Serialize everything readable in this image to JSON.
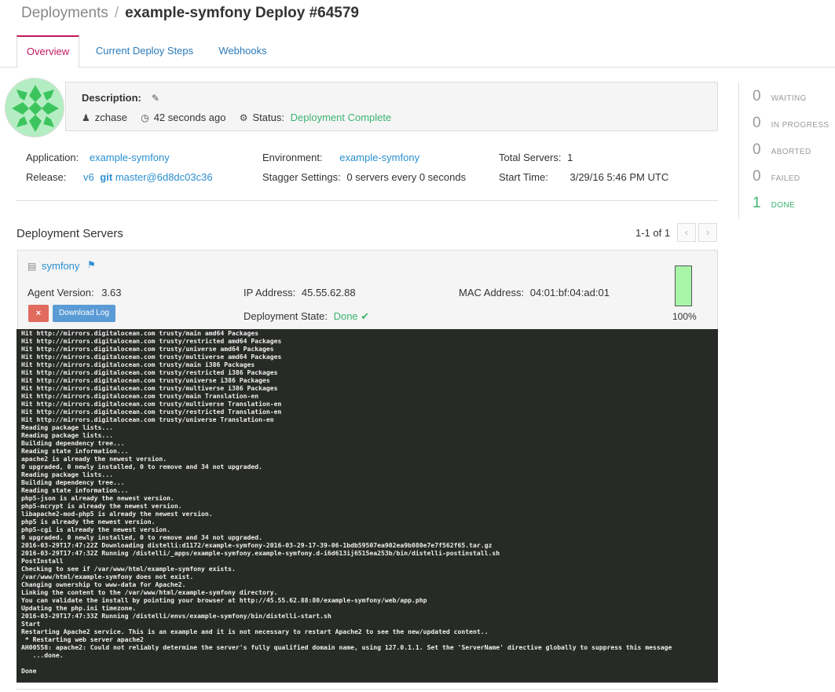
{
  "breadcrumb": {
    "parent": "Deployments",
    "separator": "/",
    "current": "example-symfony Deploy #64579"
  },
  "tabs": [
    {
      "label": "Overview",
      "active": true
    },
    {
      "label": "Current Deploy Steps",
      "active": false
    },
    {
      "label": "Webhooks",
      "active": false
    }
  ],
  "description": {
    "label": "Description:",
    "user": "zchase",
    "time": "42 seconds ago",
    "status_label": "Status:",
    "status_value": "Deployment Complete"
  },
  "info": {
    "application_label": "Application:",
    "application_value": "example-symfony",
    "environment_label": "Environment:",
    "environment_value": "example-symfony",
    "total_servers_label": "Total Servers:",
    "total_servers_value": "1",
    "release_label": "Release:",
    "release_value": "v6",
    "git_label": "git",
    "git_value": "master@6d8dc03c36",
    "stagger_label": "Stagger Settings:",
    "stagger_value": "0 servers every 0 seconds",
    "start_label": "Start Time:",
    "start_value": "3/29/16 5:46 PM UTC"
  },
  "servers": {
    "title": "Deployment Servers",
    "pagination": "1-1 of 1",
    "prev": "‹",
    "next": "›",
    "server": {
      "name": "symfony",
      "agent_label": "Agent Version:",
      "agent_value": "3.63",
      "ip_label": "IP Address:",
      "ip_value": "45.55.62.88",
      "mac_label": "MAC Address:",
      "mac_value": "04:01:bf:04:ad:01",
      "state_label": "Deployment State:",
      "state_value": "Done",
      "abort_label": "×",
      "download_label": "Download Log",
      "progress_text": "100%",
      "progress_fraction": 1.0
    }
  },
  "stats": [
    {
      "value": "0",
      "label": "WAITING"
    },
    {
      "value": "0",
      "label": "IN PROGRESS"
    },
    {
      "value": "0",
      "label": "ABORTED"
    },
    {
      "value": "0",
      "label": "FAILED"
    },
    {
      "value": "1",
      "label": "DONE"
    }
  ],
  "log_lines": [
    "Hit http://mirrors.digitalocean.com trusty/main amd64 Packages",
    "Hit http://mirrors.digitalocean.com trusty/restricted amd64 Packages",
    "Hit http://mirrors.digitalocean.com trusty/universe amd64 Packages",
    "Hit http://mirrors.digitalocean.com trusty/multiverse amd64 Packages",
    "Hit http://mirrors.digitalocean.com trusty/main i386 Packages",
    "Hit http://mirrors.digitalocean.com trusty/restricted i386 Packages",
    "Hit http://mirrors.digitalocean.com trusty/universe i386 Packages",
    "Hit http://mirrors.digitalocean.com trusty/multiverse i386 Packages",
    "Hit http://mirrors.digitalocean.com trusty/main Translation-en",
    "Hit http://mirrors.digitalocean.com trusty/multiverse Translation-en",
    "Hit http://mirrors.digitalocean.com trusty/restricted Translation-en",
    "Hit http://mirrors.digitalocean.com trusty/universe Translation-en",
    "Reading package lists...",
    "Reading package lists...",
    "Building dependency tree...",
    "Reading state information...",
    "apache2 is already the newest version.",
    "0 upgraded, 0 newly installed, 0 to remove and 34 not upgraded.",
    "Reading package lists...",
    "Building dependency tree...",
    "Reading state information...",
    "php5-json is already the newest version.",
    "php5-mcrypt is already the newest version.",
    "libapache2-mod-php5 is already the newest version.",
    "php5 is already the newest version.",
    "php5-cgi is already the newest version.",
    "0 upgraded, 0 newly installed, 0 to remove and 34 not upgraded.",
    "2016-03-29T17:47:22Z Downloading distelli:d1172/example-symfony-2016-03-29-17-39-06-1bdb59507ea902ea9b080e7e7f562f65.tar.gz",
    "2016-03-29T17:47:32Z Running /distelli/_apps/example-symfony.example-symfony.d-i6d613ij6515ea253b/bin/distelli-postinstall.sh",
    "PostInstall",
    "Checking to see if /var/www/html/example-symfony exists.",
    "/var/www/html/example-symfony does not exist.",
    "Changing ownership to www-data for Apache2.",
    "Linking the content to the /var/www/html/example-symfony directory.",
    "You can validate the install by pointing your browser at http://45.55.62.88:80/example-symfony/web/app.php",
    "Updating the php.ini timezone.",
    "2016-03-29T17:47:33Z Running /distelli/envs/example-symfony/bin/distelli-start.sh",
    "Start",
    "Restarting Apache2 service. This is an example and it is not necessary to restart Apache2 to see the new/updated content..",
    " * Restarting web server apache2",
    "AH00558: apache2: Could not reliably determine the server's fully qualified domain name, using 127.0.1.1. Set the 'ServerName' directive globally to suppress this message",
    "   ...done.",
    "",
    "Done"
  ]
}
